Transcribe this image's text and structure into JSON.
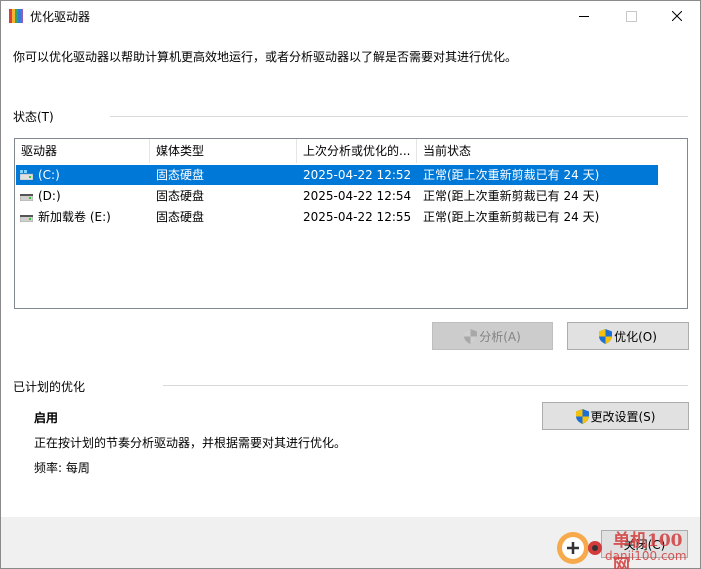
{
  "window": {
    "title": "优化驱动器",
    "icon": "defrag-app-icon"
  },
  "description": "你可以优化驱动器以帮助计算机更高效地运行，或者分析驱动器以了解是否需要对其进行优化。",
  "status": {
    "label": "状态(T)",
    "columns": [
      "驱动器",
      "媒体类型",
      "上次分析或优化的...",
      "当前状态"
    ],
    "rows": [
      {
        "drive": "(C:)",
        "media": "固态硬盘",
        "last": "2025-04-22 12:52",
        "state": "正常(距上次重新剪裁已有 24 天)",
        "icon": "system-drive-icon",
        "selected": true
      },
      {
        "drive": "(D:)",
        "media": "固态硬盘",
        "last": "2025-04-22 12:54",
        "state": "正常(距上次重新剪裁已有 24 天)",
        "icon": "drive-icon",
        "selected": false
      },
      {
        "drive": "新加载卷 (E:)",
        "media": "固态硬盘",
        "last": "2025-04-22 12:55",
        "state": "正常(距上次重新剪裁已有 24 天)",
        "icon": "drive-icon",
        "selected": false
      }
    ]
  },
  "buttons": {
    "analyze": "分析(A)",
    "optimize": "优化(O)",
    "change_settings": "更改设置(S)",
    "close": "关闭(C)"
  },
  "scheduled": {
    "label": "已计划的优化",
    "state": "启用",
    "description": "正在按计划的节奏分析驱动器，并根据需要对其进行优化。",
    "frequency": "频率: 每周"
  },
  "watermark": {
    "line1": "单机100网",
    "line2": "danji100.com"
  },
  "colors": {
    "selection": "#0078d7",
    "footer": "#f0f0f0"
  }
}
